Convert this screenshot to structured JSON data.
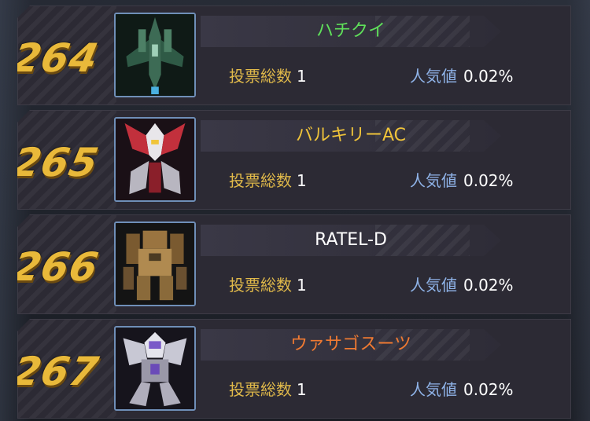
{
  "stats_labels": {
    "votes": "投票総数",
    "popularity": "人気値"
  },
  "entries": [
    {
      "rank": "264",
      "name": "ハチクイ",
      "name_color": "#5fe05a",
      "votes": "1",
      "popularity": "0.02%",
      "mecha_icon": "green-fighter-mecha",
      "accent": "#3f7a5a"
    },
    {
      "rank": "265",
      "name": "バルキリーAC",
      "name_color": "#f0c43a",
      "votes": "1",
      "popularity": "0.02%",
      "mecha_icon": "red-white-valkyrie-mecha",
      "accent": "#c2303c"
    },
    {
      "rank": "266",
      "name": "RATEL-D",
      "name_color": "#ffffff",
      "votes": "1",
      "popularity": "0.02%",
      "mecha_icon": "tan-armored-mecha",
      "accent": "#b07a3a"
    },
    {
      "rank": "267",
      "name": "ウァサゴスーツ",
      "name_color": "#f07a32",
      "votes": "1",
      "popularity": "0.02%",
      "mecha_icon": "white-purple-mecha",
      "accent": "#7a5ac8"
    }
  ]
}
